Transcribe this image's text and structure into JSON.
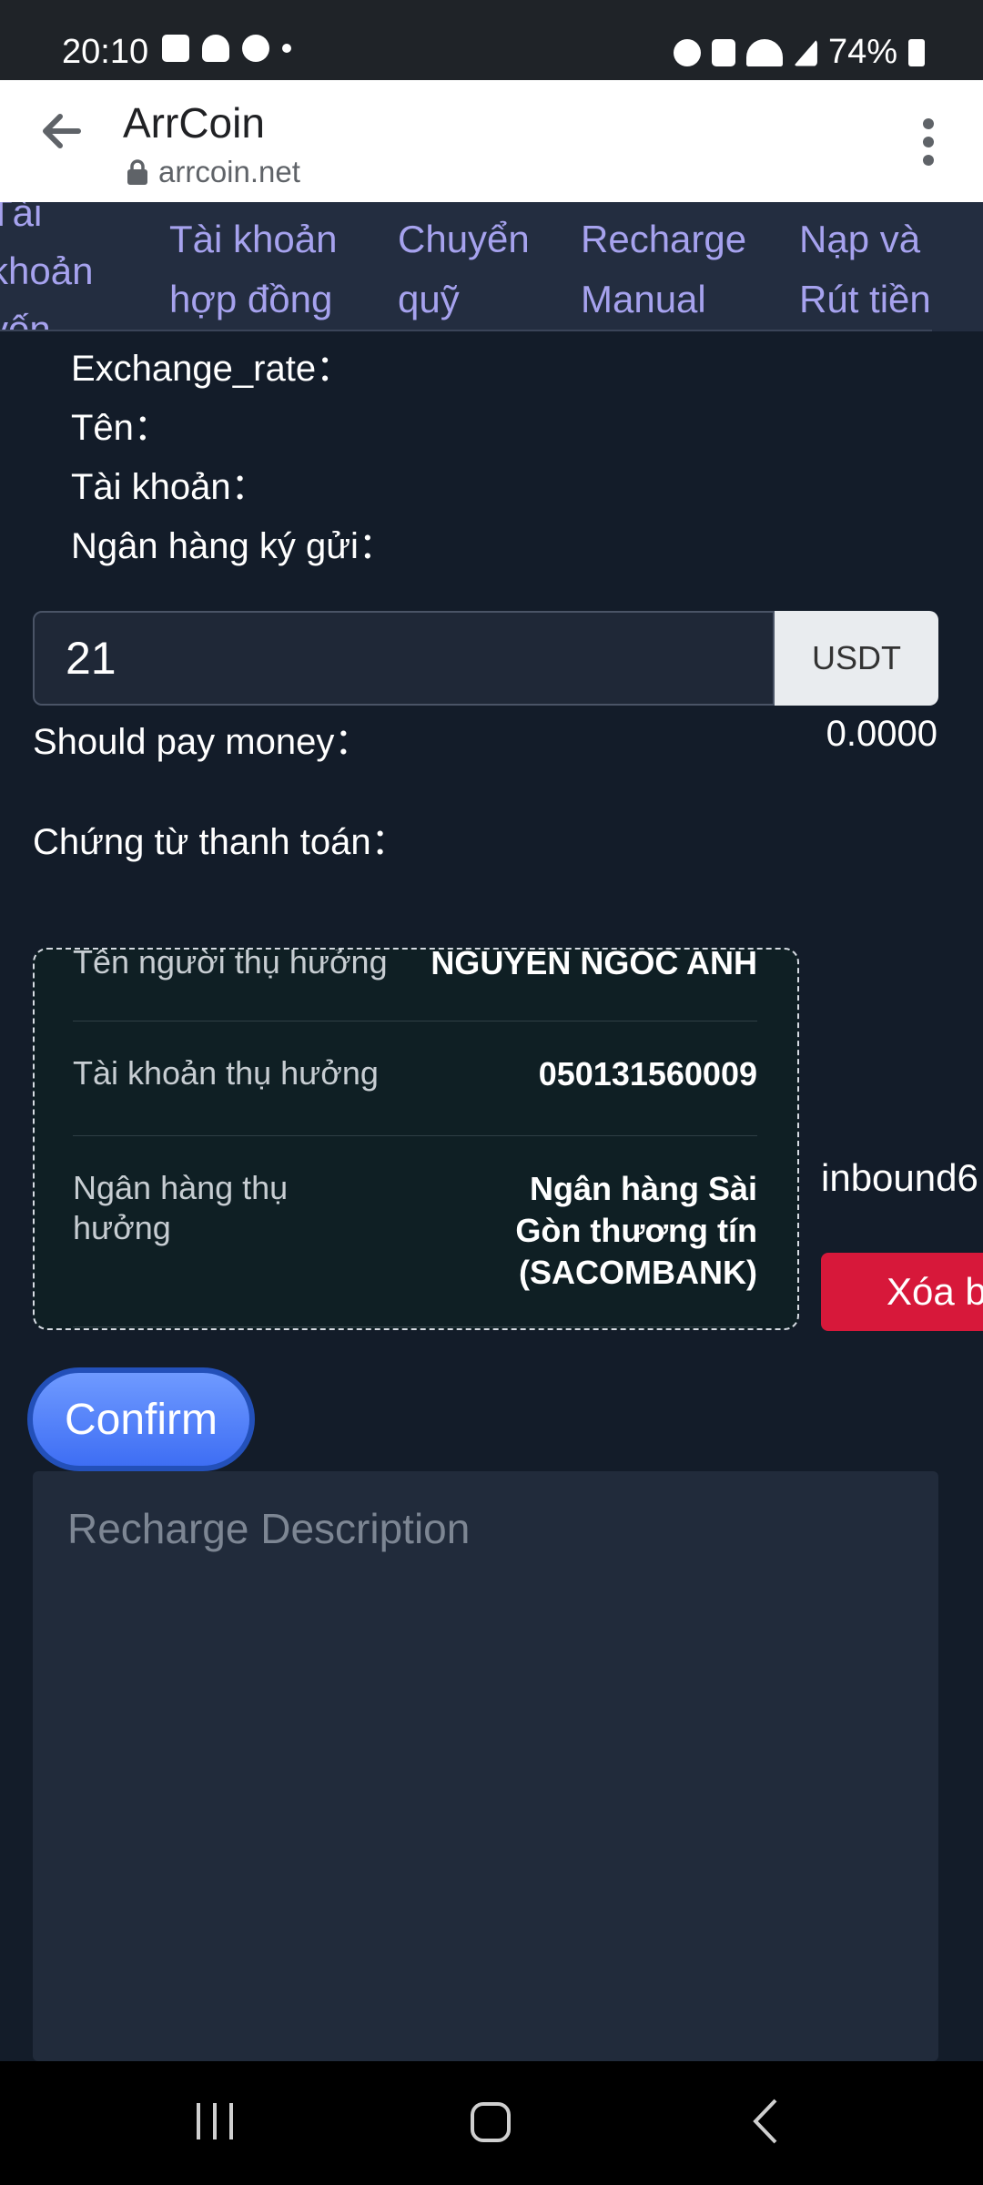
{
  "status_bar": {
    "time": "20:10",
    "battery": "74%"
  },
  "browser": {
    "title": "ArrCoin",
    "url": "arrcoin.net"
  },
  "tabs": [
    {
      "label_line1": "Tài",
      "label_line2": "khoản",
      "label_line3": "vốn"
    },
    {
      "label_line1": "Tài khoản",
      "label_line2": "hợp đồng"
    },
    {
      "label_line1": "Chuyển",
      "label_line2": "quỹ"
    },
    {
      "label_line1": "Recharge",
      "label_line2": "Manual",
      "active": true
    },
    {
      "label_line1": "Nạp và",
      "label_line2": "Rút tiền"
    }
  ],
  "info": {
    "exchange_rate_label": "Exchange_rate：",
    "name_label": "Tên：",
    "account_label": "Tài khoản：",
    "bank_label": "Ngân hàng ký gửi："
  },
  "amount": {
    "value": "21",
    "unit": "USDT"
  },
  "should_pay": {
    "label": "Should pay money：",
    "value": "0.0000"
  },
  "voucher_label": "Chứng từ thanh toán：",
  "beneficiary": {
    "name_label": "Tên người thụ hưởng",
    "name_value": "NGUYEN NGOC ANH",
    "account_label": "Tài khoản thụ hưởng",
    "account_value": "050131560009",
    "bank_label_line1": "Ngân hàng thụ",
    "bank_label_line2": "hưởng",
    "bank_value_line1": "Ngân hàng Sài",
    "bank_value_line2": "Gòn thương tín",
    "bank_value_line3": "(SACOMBANK)"
  },
  "file_name": "inbound6",
  "delete_label": "Xóa b",
  "confirm_label": "Confirm",
  "description_placeholder": "Recharge Description",
  "colors": {
    "background": "#131c29",
    "tab_text": "#a6a2ee",
    "confirm": "#3e6ef4",
    "delete": "#d7183a"
  }
}
